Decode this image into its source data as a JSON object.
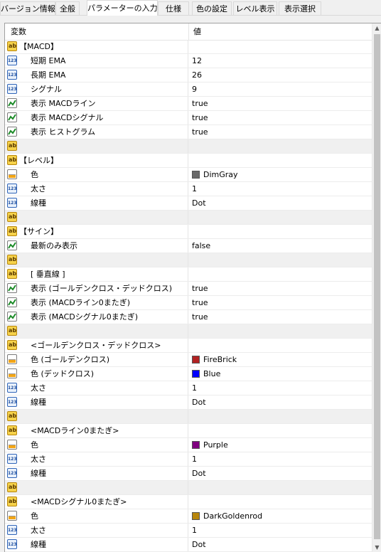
{
  "tabs": [
    {
      "label": "バージョン情報",
      "active": false
    },
    {
      "label": "全般",
      "active": false
    },
    {
      "label": "パラメーターの入力",
      "active": true
    },
    {
      "label": "仕様",
      "active": false
    },
    {
      "label": "色の設定",
      "active": false
    },
    {
      "label": "レベル表示",
      "active": false
    },
    {
      "label": "表示選択",
      "active": false
    }
  ],
  "header": {
    "col_variable": "変数",
    "col_value": "値"
  },
  "rows": [
    {
      "type": "string",
      "indent": false,
      "label": "【MACD】",
      "value": ""
    },
    {
      "type": "number",
      "indent": true,
      "label": "短期 EMA",
      "value": "12"
    },
    {
      "type": "number",
      "indent": true,
      "label": "長期 EMA",
      "value": "26"
    },
    {
      "type": "number",
      "indent": true,
      "label": "シグナル",
      "value": "9"
    },
    {
      "type": "bool",
      "indent": true,
      "label": "表示 MACDライン",
      "value": "true"
    },
    {
      "type": "bool",
      "indent": true,
      "label": "表示 MACDシグナル",
      "value": "true"
    },
    {
      "type": "bool",
      "indent": true,
      "label": "表示 ヒストグラム",
      "value": "true"
    },
    {
      "type": "string",
      "indent": false,
      "label": "",
      "value": "",
      "gray": true
    },
    {
      "type": "string",
      "indent": false,
      "label": "【レベル】",
      "value": ""
    },
    {
      "type": "color",
      "indent": true,
      "label": "色",
      "value": "DimGray",
      "swatch": "#696969"
    },
    {
      "type": "number",
      "indent": true,
      "label": "太さ",
      "value": "1"
    },
    {
      "type": "number",
      "indent": true,
      "label": "線種",
      "value": "Dot"
    },
    {
      "type": "string",
      "indent": false,
      "label": "",
      "value": "",
      "gray": true
    },
    {
      "type": "string",
      "indent": false,
      "label": "【サイン】",
      "value": ""
    },
    {
      "type": "bool",
      "indent": true,
      "label": "最新のみ表示",
      "value": "false"
    },
    {
      "type": "string",
      "indent": false,
      "label": "",
      "value": "",
      "gray": true
    },
    {
      "type": "string",
      "indent": true,
      "label": "[ 垂直線 ]",
      "value": ""
    },
    {
      "type": "bool",
      "indent": true,
      "label": "表示 (ゴールデンクロス・デッドクロス)",
      "value": "true"
    },
    {
      "type": "bool",
      "indent": true,
      "label": "表示 (MACDライン0またぎ)",
      "value": "true"
    },
    {
      "type": "bool",
      "indent": true,
      "label": "表示 (MACDシグナル0またぎ)",
      "value": "true"
    },
    {
      "type": "string",
      "indent": false,
      "label": "",
      "value": "",
      "gray": true
    },
    {
      "type": "string",
      "indent": true,
      "label": "<ゴールデンクロス・デッドクロス>",
      "value": ""
    },
    {
      "type": "color",
      "indent": true,
      "label": "色 (ゴールデンクロス)",
      "value": "FireBrick",
      "swatch": "#b22222"
    },
    {
      "type": "color",
      "indent": true,
      "label": "色 (デッドクロス)",
      "value": "Blue",
      "swatch": "#0000ff"
    },
    {
      "type": "number",
      "indent": true,
      "label": "太さ",
      "value": "1"
    },
    {
      "type": "number",
      "indent": true,
      "label": "線種",
      "value": "Dot"
    },
    {
      "type": "string",
      "indent": false,
      "label": "",
      "value": "",
      "gray": true
    },
    {
      "type": "string",
      "indent": true,
      "label": "<MACDライン0またぎ>",
      "value": ""
    },
    {
      "type": "color",
      "indent": true,
      "label": "色",
      "value": "Purple",
      "swatch": "#800080"
    },
    {
      "type": "number",
      "indent": true,
      "label": "太さ",
      "value": "1"
    },
    {
      "type": "number",
      "indent": true,
      "label": "線種",
      "value": "Dot"
    },
    {
      "type": "string",
      "indent": false,
      "label": "",
      "value": "",
      "gray": true
    },
    {
      "type": "string",
      "indent": true,
      "label": "<MACDシグナル0またぎ>",
      "value": ""
    },
    {
      "type": "color",
      "indent": true,
      "label": "色",
      "value": "DarkGoldenrod",
      "swatch": "#b8860b"
    },
    {
      "type": "number",
      "indent": true,
      "label": "太さ",
      "value": "1"
    },
    {
      "type": "number",
      "indent": true,
      "label": "線種",
      "value": "Dot"
    }
  ],
  "icons": {
    "string": "ab-string-icon",
    "number": "number-123-icon",
    "bool": "boolean-chart-icon",
    "color": "color-palette-icon"
  }
}
